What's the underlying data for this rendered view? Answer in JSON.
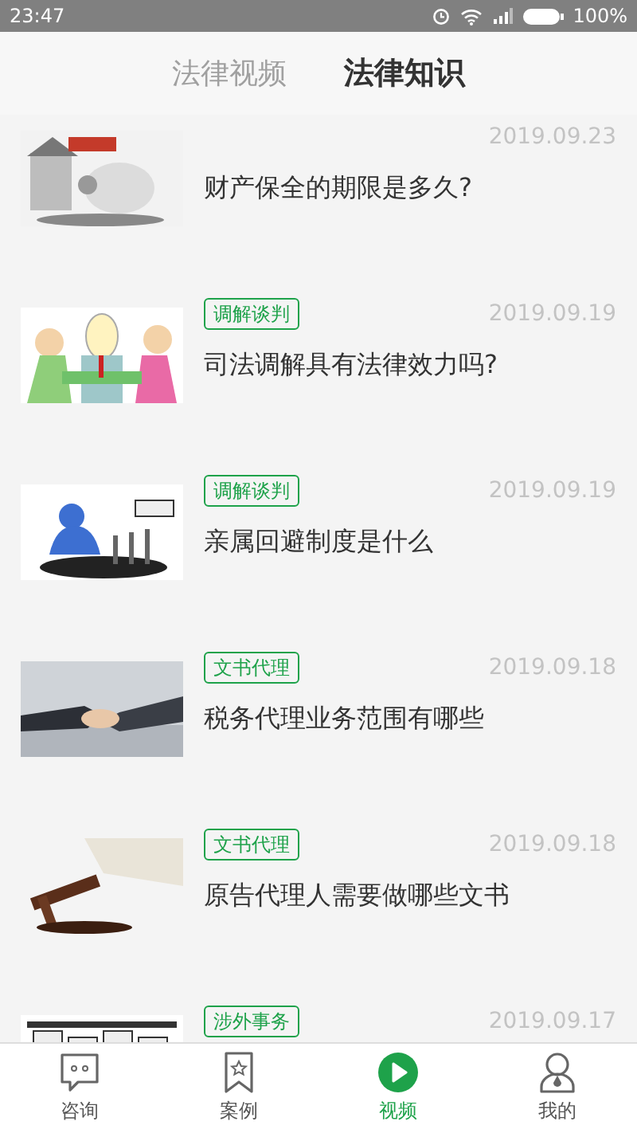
{
  "status_bar": {
    "time": "23:47",
    "battery": "100%"
  },
  "top_tabs": [
    {
      "label": "法律视频",
      "selected": false
    },
    {
      "label": "法律知识",
      "selected": true
    }
  ],
  "articles": [
    {
      "date": "2019.09.23",
      "title": "财产保全的期限是多久?"
    },
    {
      "tag": "调解谈判",
      "date": "2019.09.19",
      "title": "司法调解具有法律效力吗?"
    },
    {
      "tag": "调解谈判",
      "date": "2019.09.19",
      "title": "亲属回避制度是什么"
    },
    {
      "tag": "文书代理",
      "date": "2019.09.18",
      "title": "税务代理业务范围有哪些"
    },
    {
      "tag": "文书代理",
      "date": "2019.09.18",
      "title": "原告代理人需要做哪些文书"
    },
    {
      "tag": "涉外事务",
      "date": "2019.09.17"
    }
  ],
  "bottom_nav": [
    {
      "label": "咨询",
      "kind": "chat",
      "selected": false
    },
    {
      "label": "案例",
      "kind": "bookmark",
      "selected": false
    },
    {
      "label": "视频",
      "kind": "play",
      "selected": true
    },
    {
      "label": "我的",
      "kind": "person",
      "selected": false
    }
  ]
}
